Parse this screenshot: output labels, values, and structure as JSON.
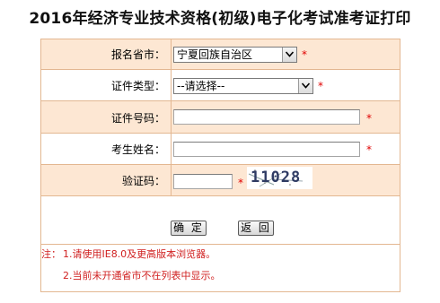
{
  "page": {
    "title": "2016年经济专业技术资格(初级)电子化考试准考证打印"
  },
  "form": {
    "province": {
      "label": "报名省市：",
      "selected": "宁夏回族自治区"
    },
    "id_type": {
      "label": "证件类型：",
      "selected": "--请选择--"
    },
    "id_number": {
      "label": "证件号码：",
      "value": ""
    },
    "name": {
      "label": "考生姓名：",
      "value": ""
    },
    "captcha": {
      "label": "验证码：",
      "value": "",
      "image_text": "11028"
    },
    "required_mark": "*"
  },
  "buttons": {
    "confirm": "确 定",
    "back": "返 回"
  },
  "notes": {
    "prefix": "注：",
    "item1": "1.请使用IE8.0及更高版本浏览器。",
    "item2": "2.当前未开通省市不在列表中显示。"
  },
  "colors": {
    "row_shade": "#fde7d3",
    "border": "#e3b791",
    "required": "#e00000",
    "note_text": "#d02020"
  }
}
